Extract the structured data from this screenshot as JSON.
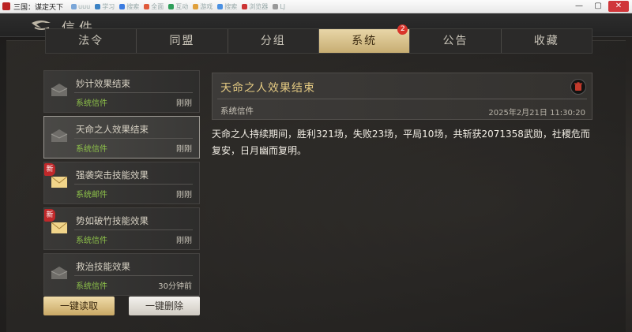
{
  "window": {
    "title": "三国：谋定天下",
    "tabs": [
      "uuu",
      "学习",
      "搜索",
      "全面",
      "互动",
      "游戏",
      "搜索",
      "浏览器",
      "LJ"
    ],
    "controls": {
      "minimize": "—",
      "maximize": "▢",
      "close": "✕"
    }
  },
  "header": {
    "title": "信件"
  },
  "tabs": [
    {
      "label": "法令",
      "badge": ""
    },
    {
      "label": "同盟",
      "badge": ""
    },
    {
      "label": "分组",
      "badge": ""
    },
    {
      "label": "系统",
      "badge": "2"
    },
    {
      "label": "公告",
      "badge": ""
    },
    {
      "label": "收藏",
      "badge": ""
    }
  ],
  "active_tab": "系统",
  "mails": [
    {
      "title": "妙计效果结束",
      "type": "系统信件",
      "time": "刚刚",
      "is_new": false,
      "read": true,
      "new_label": ""
    },
    {
      "title": "天命之人效果结束",
      "type": "系统信件",
      "time": "刚刚",
      "is_new": false,
      "read": true,
      "new_label": ""
    },
    {
      "title": "强袭突击技能效果",
      "type": "系统邮件",
      "time": "刚刚",
      "is_new": true,
      "read": false,
      "new_label": "新"
    },
    {
      "title": "势如破竹技能效果",
      "type": "系统信件",
      "time": "刚刚",
      "is_new": true,
      "read": false,
      "new_label": "新"
    },
    {
      "title": "救治技能效果",
      "type": "系统信件",
      "time": "30分钟前",
      "is_new": false,
      "read": true,
      "new_label": ""
    }
  ],
  "buttons": {
    "read_all": "一键读取",
    "delete_all": "一键删除"
  },
  "detail": {
    "title": "天命之人效果结束",
    "type": "系统信件",
    "date": "2025年2月21日 11:30:20",
    "body": "天命之人持续期间，胜利321场，失败23场，平局10场，共斩获2071358武勋，社稷危而复安，日月幽而复明。"
  },
  "colors": {
    "accent_gold": "#e3c982",
    "active_tab": "#d9c58f",
    "mail_type_green": "#8ec24a",
    "badge_red": "#d9342b"
  }
}
